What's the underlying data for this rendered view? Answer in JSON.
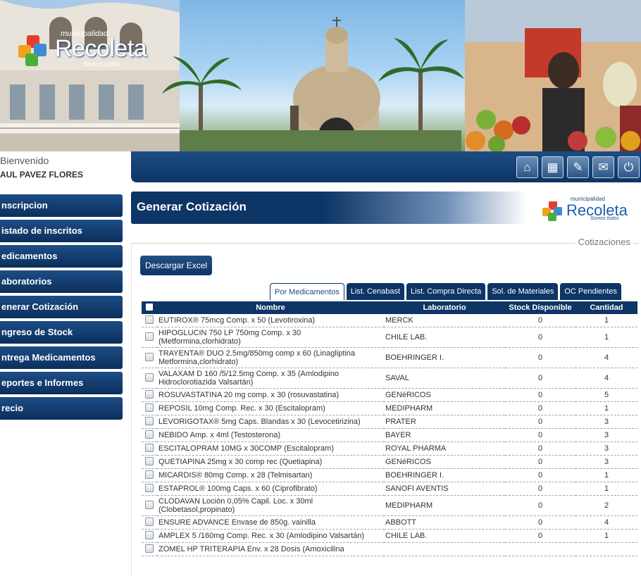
{
  "logo": {
    "small": "municipalidad",
    "name": "Recoleta",
    "tagline": "Somos todos"
  },
  "user": {
    "welcome": "Bienvenido",
    "name": "AUL PAVEZ FLORES"
  },
  "nav_icons": [
    "home-icon",
    "sitemap-icon",
    "pencil-icon",
    "mail-icon",
    "power-icon"
  ],
  "sidebar": {
    "items": [
      {
        "label": "nscripcion"
      },
      {
        "label": "istado de inscritos"
      },
      {
        "label": "edicamentos"
      },
      {
        "label": "aboratorios"
      },
      {
        "label": "enerar Cotización"
      },
      {
        "label": "ngreso de Stock"
      },
      {
        "label": "ntrega Medicamentos"
      },
      {
        "label": "eportes e Informes"
      },
      {
        "label": "recio"
      }
    ]
  },
  "page": {
    "title": "Generar Cotización",
    "section": "Cotizaciones",
    "excel_button": "Descargar Excel"
  },
  "tabs": [
    {
      "label": "Por Medicamentos",
      "active": true
    },
    {
      "label": "List. Cenabast",
      "active": false
    },
    {
      "label": "List. Compra Directa",
      "active": false
    },
    {
      "label": "Sol. de Materiales",
      "active": false
    },
    {
      "label": "OC Pendientes",
      "active": false
    }
  ],
  "table": {
    "columns": [
      "Nombre",
      "Laboratorio",
      "Stock Disponible",
      "Cantidad"
    ],
    "rows": [
      {
        "nombre": "EUTIROX® 75mcg Comp. x 50 (Levotiroxina)",
        "laboratorio": "MERCK",
        "stock": "0",
        "cantidad": "1"
      },
      {
        "nombre": "HIPOGLUCIN 750 LP 750mg Comp. x 30 (Metformina,clorhidrato)",
        "laboratorio": "CHILE LAB.",
        "stock": "0",
        "cantidad": "1"
      },
      {
        "nombre": "TRAYENTA® DUO 2.5mg/850mg comp x 60 (Linagliptina Metformina,clorhidrato)",
        "laboratorio": "BOEHRINGER I.",
        "stock": "0",
        "cantidad": "4"
      },
      {
        "nombre": "VALAXAM D 160 /5/12.5mg Comp. x 35 (Amlodipino Hidroclorotiazida Valsartán)",
        "laboratorio": "SAVAL",
        "stock": "0",
        "cantidad": "4"
      },
      {
        "nombre": "ROSUVASTATINA 20 mg comp. x 30 (rosuvastatina)",
        "laboratorio": "GENéRICOS",
        "stock": "0",
        "cantidad": "5"
      },
      {
        "nombre": "REPOSIL 10mg Comp. Rec. x 30 (Escitalopram)",
        "laboratorio": "MEDIPHARM",
        "stock": "0",
        "cantidad": "1"
      },
      {
        "nombre": "LEVORIGOTAX® 5mg Caps. Blandas x 30 (Levocetirizina)",
        "laboratorio": "PRATER",
        "stock": "0",
        "cantidad": "3"
      },
      {
        "nombre": "NEBIDO Amp. x 4ml (Testosterona)",
        "laboratorio": "BAYER",
        "stock": "0",
        "cantidad": "3"
      },
      {
        "nombre": "ESCITALOPRAM 10MG x 30COMP (Escitalopram)",
        "laboratorio": "ROYAL PHARMA",
        "stock": "0",
        "cantidad": "3"
      },
      {
        "nombre": "QUETIAPINA 25mg x 30 comp rec (Quetiapina)",
        "laboratorio": "GENéRICOS",
        "stock": "0",
        "cantidad": "3"
      },
      {
        "nombre": "MICARDIS® 80mg Comp. x 28 (Telmisartan)",
        "laboratorio": "BOEHRINGER I.",
        "stock": "0",
        "cantidad": "1"
      },
      {
        "nombre": "ESTAPROL® 100mg Caps. x 60 (Ciprofibrato)",
        "laboratorio": "SANOFI AVENTIS",
        "stock": "0",
        "cantidad": "1"
      },
      {
        "nombre": "CLODAVAN Loción 0,05% Capil. Loc. x 30ml (Clobetasol,propinato)",
        "laboratorio": "MEDIPHARM",
        "stock": "0",
        "cantidad": "2"
      },
      {
        "nombre": "ENSURE ADVANCE Envase de 850g. vainilla",
        "laboratorio": "ABBOTT",
        "stock": "0",
        "cantidad": "4"
      },
      {
        "nombre": "AMPLEX 5 /160mg Comp. Rec. x 30 (Amlodipino Valsartán)",
        "laboratorio": "CHILE LAB.",
        "stock": "0",
        "cantidad": "1"
      },
      {
        "nombre": "ZOMEL HP TRITERAPIA Env. x 28 Dosis (Amoxicilina",
        "laboratorio": "",
        "stock": "",
        "cantidad": ""
      }
    ]
  },
  "colors": {
    "primary": "#0d3565",
    "accent": "#1d4d86"
  }
}
